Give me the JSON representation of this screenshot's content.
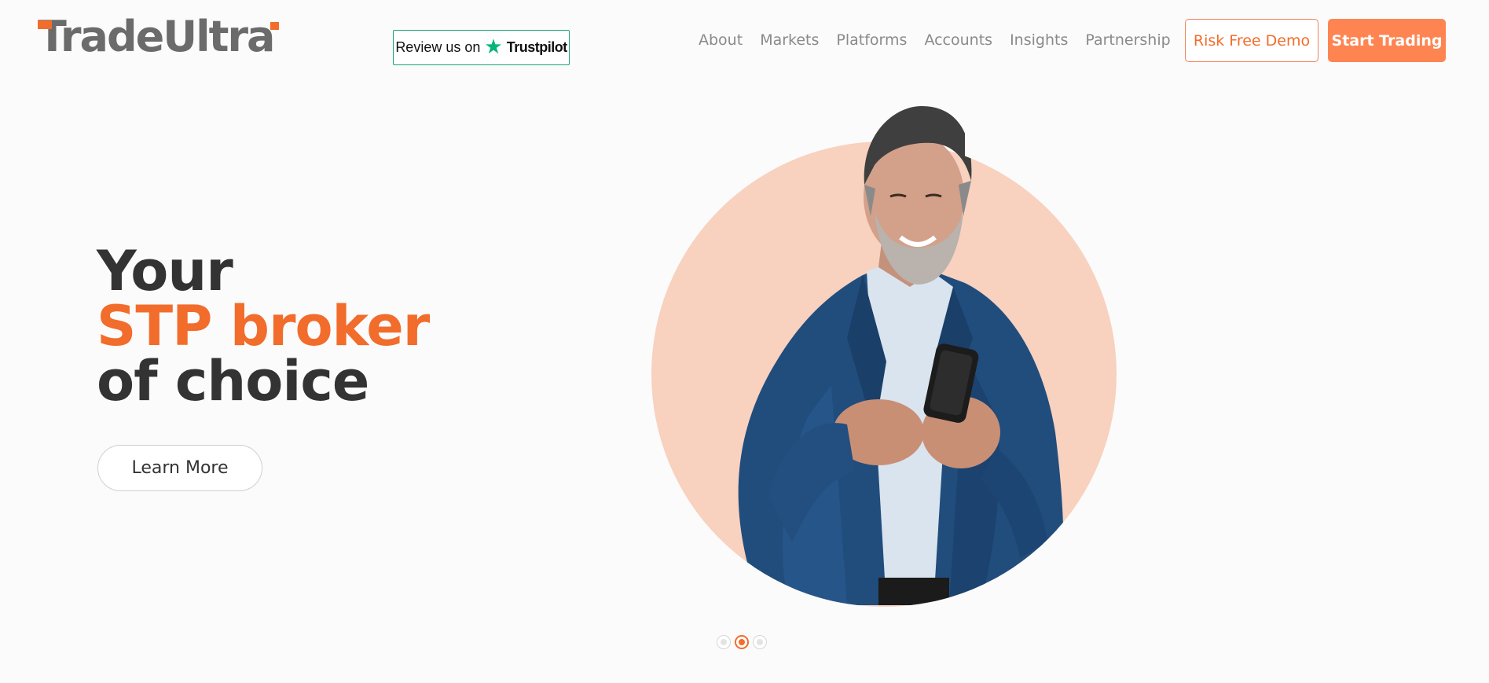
{
  "header": {
    "logo": "TradeUltra",
    "trustpilot": {
      "prefix": "Review us on",
      "brand": "Trustpilot",
      "icon": "star-icon"
    },
    "nav": [
      "About",
      "Markets",
      "Platforms",
      "Accounts",
      "Insights",
      "Partnership"
    ],
    "demo_button": "Risk Free Demo",
    "trade_button": "Start Trading"
  },
  "hero": {
    "headline": {
      "line1": "Your",
      "line2": "STP broker",
      "line3": "of choice"
    },
    "cta": "Learn More",
    "image": "smiling-man-with-phone"
  },
  "carousel": {
    "slides": 3,
    "active": 2
  },
  "colors": {
    "accent": "#f26c2b",
    "button": "#fe8552",
    "circle": "#f8d1bf",
    "text_dark": "#333333",
    "nav": "#8a8a8a"
  }
}
